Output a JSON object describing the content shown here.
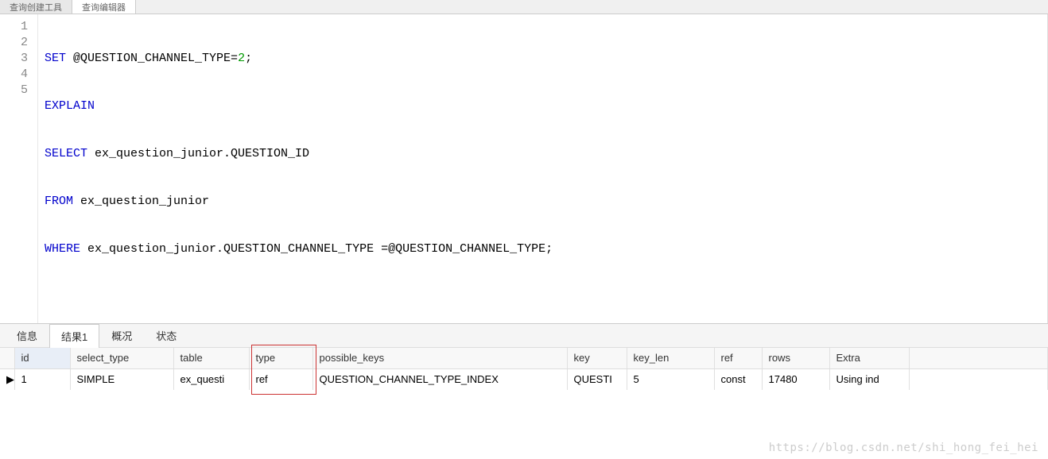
{
  "topTabs": {
    "tab1": "查询创建工具",
    "tab2": "查询编辑器"
  },
  "code": {
    "lines": [
      "1",
      "2",
      "3",
      "4",
      "5"
    ],
    "l1": {
      "k1": "SET",
      "t1": " @QUESTION_CHANNEL_TYPE=",
      "n1": "2",
      "t2": ";"
    },
    "l2": {
      "k1": "EXPLAIN"
    },
    "l3": {
      "k1": "SELECT",
      "t1": " ex_question_junior.QUESTION_ID"
    },
    "l4": {
      "k1": "FROM",
      "t1": " ex_question_junior"
    },
    "l5": {
      "k1": "WHERE",
      "t1": " ex_question_junior.QUESTION_CHANNEL_TYPE =@QUESTION_CHANNEL_TYPE;"
    }
  },
  "bottomTabs": {
    "info": "信息",
    "result1": "结果1",
    "profile": "概况",
    "status": "状态"
  },
  "results": {
    "headers": {
      "id": "id",
      "select_type": "select_type",
      "table": "table",
      "type": "type",
      "possible_keys": "possible_keys",
      "key": "key",
      "key_len": "key_len",
      "ref": "ref",
      "rows": "rows",
      "extra": "Extra"
    },
    "row": {
      "pointer": "▶",
      "id": "1",
      "select_type": "SIMPLE",
      "table": "ex_questi",
      "type": "ref",
      "possible_keys": "QUESTION_CHANNEL_TYPE_INDEX",
      "key": "QUESTI",
      "key_len": "5",
      "ref": "const",
      "rows": "17480",
      "extra": "Using ind"
    }
  },
  "watermark": "https://blog.csdn.net/shi_hong_fei_hei"
}
